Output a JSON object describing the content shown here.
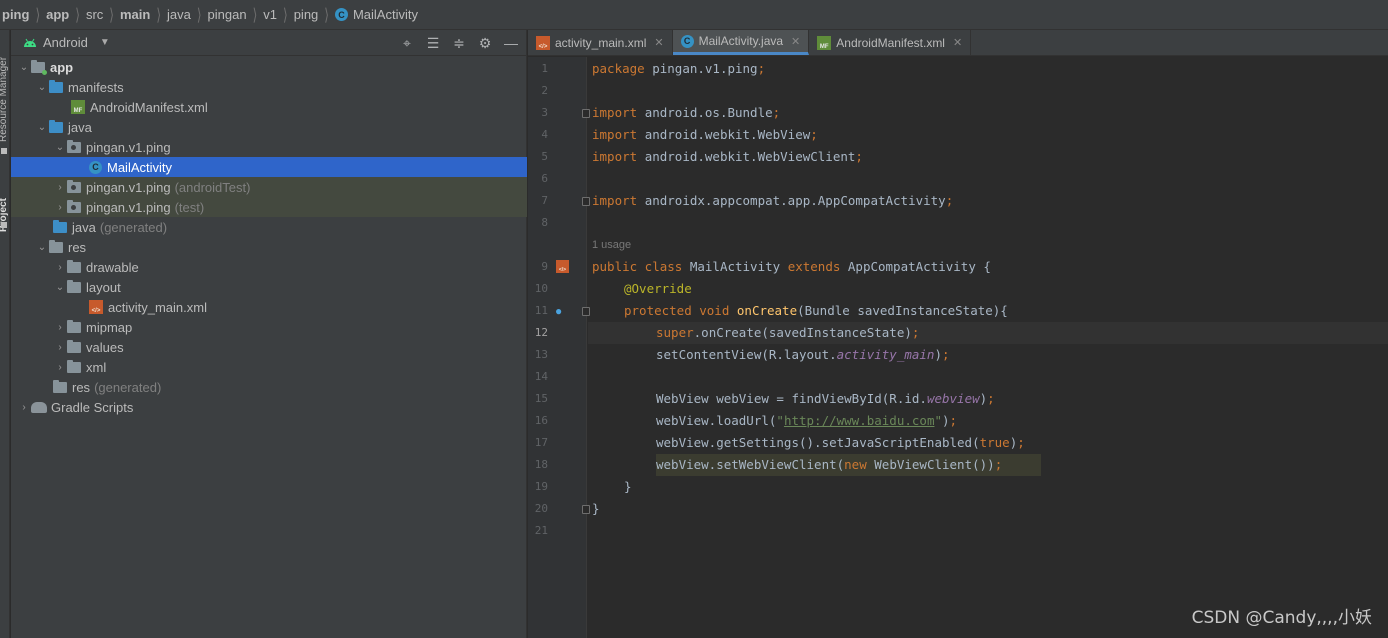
{
  "breadcrumb": {
    "items": [
      "ping",
      "app",
      "src",
      "main",
      "java",
      "pingan",
      "v1",
      "ping",
      "MailActivity"
    ]
  },
  "stripe": {
    "resource_manager": "Resource Manager",
    "project": "Project"
  },
  "project_panel": {
    "view_label": "Android",
    "tree": [
      {
        "label": "app",
        "suffix": ""
      },
      {
        "label": "manifests",
        "suffix": ""
      },
      {
        "label": "AndroidManifest.xml",
        "suffix": ""
      },
      {
        "label": "java",
        "suffix": ""
      },
      {
        "label": "pingan.v1.ping",
        "suffix": ""
      },
      {
        "label": "MailActivity",
        "suffix": ""
      },
      {
        "label": "pingan.v1.ping",
        "suffix": "(androidTest)"
      },
      {
        "label": "pingan.v1.ping",
        "suffix": "(test)"
      },
      {
        "label": "java",
        "suffix": "(generated)"
      },
      {
        "label": "res",
        "suffix": ""
      },
      {
        "label": "drawable",
        "suffix": ""
      },
      {
        "label": "layout",
        "suffix": ""
      },
      {
        "label": "activity_main.xml",
        "suffix": ""
      },
      {
        "label": "mipmap",
        "suffix": ""
      },
      {
        "label": "values",
        "suffix": ""
      },
      {
        "label": "xml",
        "suffix": ""
      },
      {
        "label": "res",
        "suffix": "(generated)"
      },
      {
        "label": "Gradle Scripts",
        "suffix": ""
      }
    ]
  },
  "tabs": [
    {
      "label": "activity_main.xml",
      "active": false
    },
    {
      "label": "MailActivity.java",
      "active": true
    },
    {
      "label": "AndroidManifest.xml",
      "active": false
    }
  ],
  "editor": {
    "line_numbers": [
      "1",
      "2",
      "3",
      "4",
      "5",
      "6",
      "7",
      "8",
      "9",
      "10",
      "11",
      "12",
      "13",
      "14",
      "15",
      "16",
      "17",
      "18",
      "19",
      "20",
      "21"
    ],
    "current_line": "12",
    "usage_hint": "1 usage",
    "code": {
      "l1_kw": "package ",
      "l1_rest": "pingan.v1.ping",
      "l3_kw": "import ",
      "l3_rest": "android.os.Bundle",
      "l4_kw": "import ",
      "l4_rest": "android.webkit.WebView",
      "l5_kw": "import ",
      "l5_rest": "android.webkit.WebViewClient",
      "l7_kw": "import ",
      "l7_rest": "androidx.appcompat.app.AppCompatActivity",
      "l9_kw1": "public class ",
      "l9_name": "MailActivity ",
      "l9_kw2": "extends ",
      "l9_rest": "AppCompatActivity {",
      "l10_ann": "@Override",
      "l11_kw": "protected void ",
      "l11_fn": "onCreate",
      "l11_rest": "(Bundle savedInstanceState){",
      "l12_kw": "super",
      "l12_rest": ".onCreate(savedInstanceState)",
      "l13_a": "setContentView(R.layout.",
      "l13_field": "activity_main",
      "l13_b": ")",
      "l15_a": "WebView webView = findViewById(R.id.",
      "l15_field": "webview",
      "l15_b": ")",
      "l16_a": "webView.loadUrl(",
      "l16_q1": "\"",
      "l16_url": "http://www.baidu.com",
      "l16_q2": "\"",
      "l16_b": ")",
      "l17_a": "webView.getSettings().setJavaScriptEnabled(",
      "l17_kw": "true",
      "l17_b": ")",
      "l18_a": "webView.setWebViewClient(",
      "l18_kw": "new ",
      "l18_b": "WebViewClient())",
      "l19": "}",
      "l20": "}",
      "semicolon": ";"
    }
  },
  "watermark": "CSDN @Candy,,,,小妖"
}
